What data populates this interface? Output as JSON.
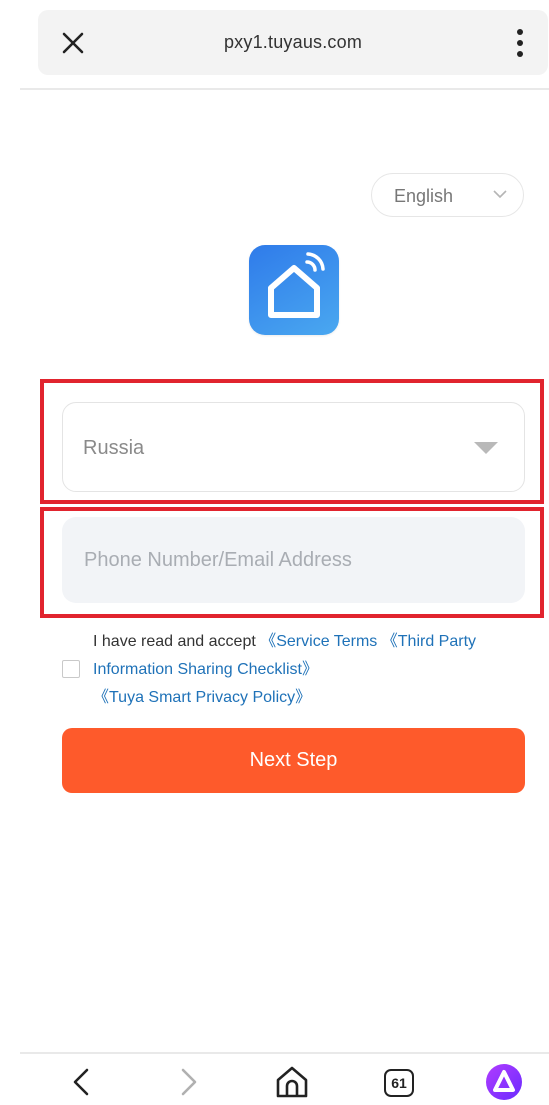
{
  "browser": {
    "url": "pxy1.tuyaus.com",
    "close_icon": "close-icon",
    "menu_icon": "more-vertical-icon"
  },
  "language_selector": {
    "selected": "English",
    "icon": "chevron-down-icon"
  },
  "logo": {
    "icon": "smart-home-icon",
    "colors": {
      "gradient_start": "#2f7bea",
      "gradient_end": "#4aa8f0"
    }
  },
  "country_select": {
    "value": "Russia",
    "icon": "caret-down-icon"
  },
  "account_input": {
    "value": "",
    "placeholder": "Phone Number/Email Address"
  },
  "agreement": {
    "checked": false,
    "prefix": "I have read and accept ",
    "service_terms": "《Service Terms",
    "third_party": "《Third Party Information Sharing Checklist》",
    "privacy": "《Tuya Smart Privacy Policy》"
  },
  "next_button": {
    "label": "Next Step",
    "color": "#fe5a2b"
  },
  "bottom_nav": {
    "tabs_count": "61",
    "icons": [
      "back-icon",
      "forward-icon",
      "home-icon",
      "tabs-icon",
      "assistant-icon"
    ]
  },
  "highlight_color": "#e1242e",
  "link_color": "#1f72b8"
}
